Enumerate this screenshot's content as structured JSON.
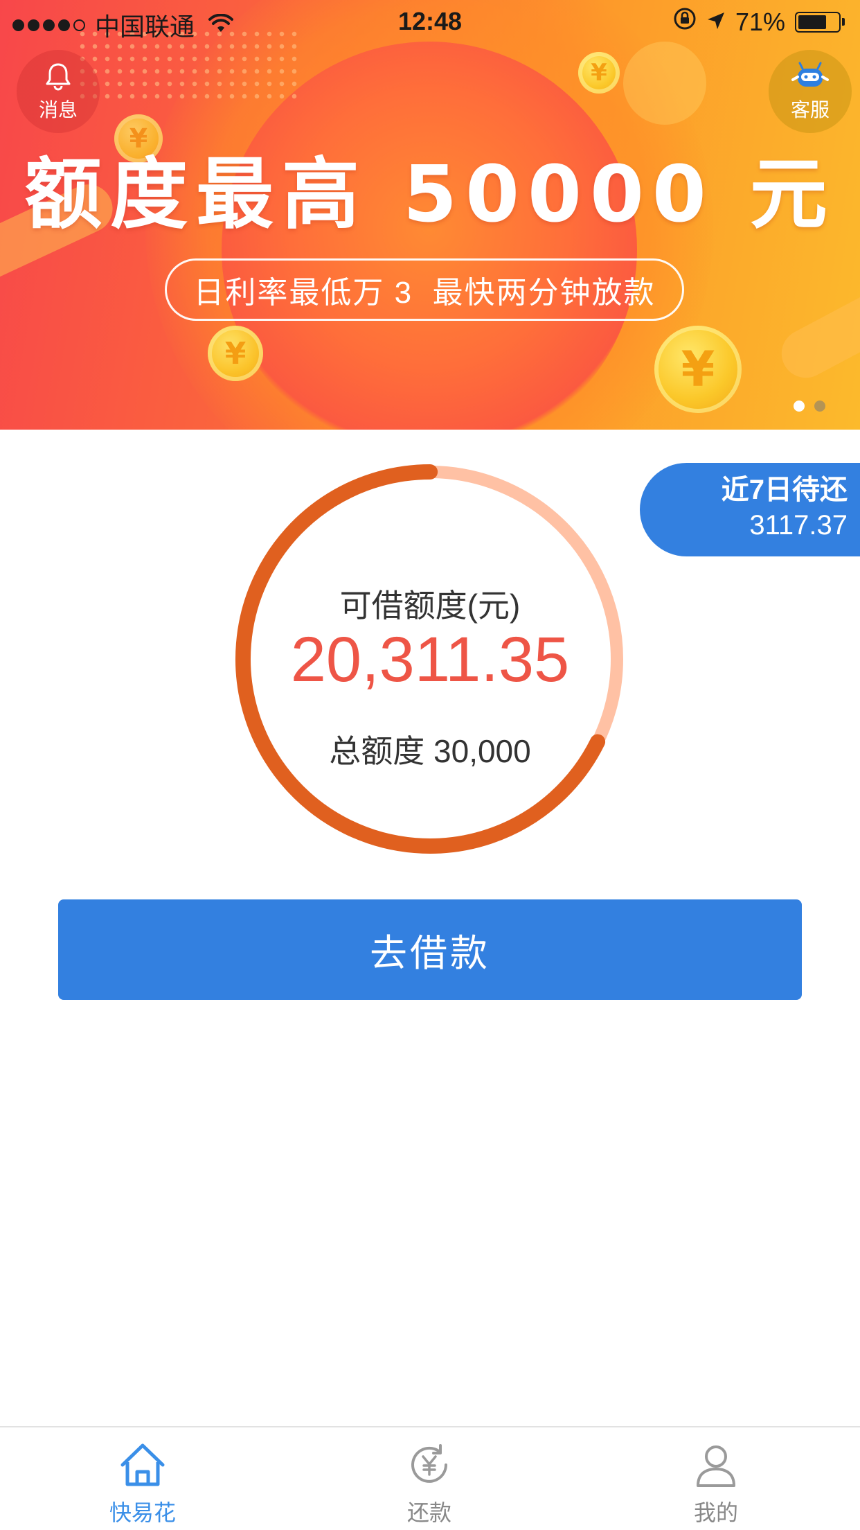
{
  "status_bar": {
    "carrier": "中国联通",
    "time": "12:48",
    "battery": "71%",
    "battery_level": 0.71
  },
  "banner": {
    "headline": "额度最高 50000 元",
    "subline": "日利率最低万 3  最快两分钟放款",
    "coin_symbol": "¥",
    "message_label": "消息",
    "service_label": "客服",
    "page_count": 2,
    "active_page": 0
  },
  "due_soon": {
    "title": "近7日待还",
    "amount": "3117.37"
  },
  "credit": {
    "available_label": "可借额度(元)",
    "available_amount": "20,311.35",
    "total_label": "总额度 30,000",
    "available_fraction": 0.677
  },
  "borrow_button": "去借款",
  "tabbar": {
    "items": [
      {
        "label": "快易花",
        "icon": "home-icon",
        "active": true
      },
      {
        "label": "还款",
        "icon": "yuan-refresh-icon",
        "active": false
      },
      {
        "label": "我的",
        "icon": "user-icon",
        "active": false
      }
    ]
  },
  "colors": {
    "primary_blue": "#3380e0",
    "amount_red": "#ee5546",
    "gauge_dark": "#e0601f",
    "gauge_light": "#ffc1a4",
    "tab_active": "#3a8fe8",
    "tab_inactive": "#888888"
  }
}
